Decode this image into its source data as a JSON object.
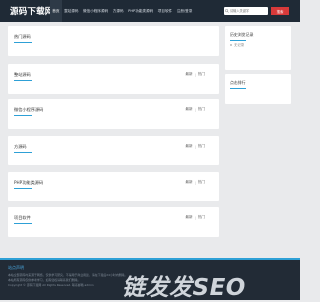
{
  "header": {
    "logo": "源码下载网",
    "nav": [
      "首页",
      "整站源码",
      "微信小程序源码",
      "方源码",
      "PHP功能类源码",
      "项目软件",
      "注册/登录"
    ],
    "search_placeholder": "请输入关键字",
    "search_button": "搜索"
  },
  "main": {
    "sections": [
      {
        "title": "热门源码",
        "links": []
      },
      {
        "title": "整站源码",
        "links": [
          "最新",
          "热门"
        ]
      },
      {
        "title": "微信小程序源码",
        "links": [
          "最新",
          "热门"
        ]
      },
      {
        "title": "方源码",
        "links": [
          "最新",
          "热门"
        ]
      },
      {
        "title": "PHP功能类源码",
        "links": [
          "最新",
          "热门"
        ]
      },
      {
        "title": "项目软件",
        "links": [
          "最新",
          "热门"
        ]
      }
    ]
  },
  "sidebar": {
    "history_title": "历史浏览记录",
    "history_empty": "无记录",
    "ranking_title": "点击排行"
  },
  "footer": {
    "title": "站点声明",
    "lines": [
      "本站全部源码均来源于网络，仅供学习研究，不得用于商业用途，请在下载后24小时内删除。",
      "本站所有源码仅供参考学习，如有侵权请联系我们删除。",
      "Copyright © 源码下载网 All Rights Reserved. 联系邮箱 admin"
    ],
    "brand": "链发发SEO"
  }
}
